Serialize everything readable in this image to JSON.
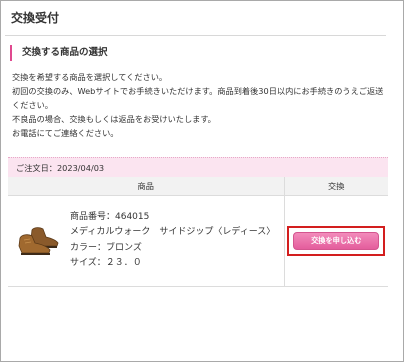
{
  "page": {
    "title": "交換受付"
  },
  "section": {
    "heading": "交換する商品の選択",
    "instructions": [
      "交換を希望する商品を選択してください。",
      "初回の交換のみ、Webサイトでお手続きいただけます。商品到着後30日以内にお手続きのうえご返送",
      "ください。",
      "不良品の場合、交換もしくは返品をお受けいたします。",
      "お電話にてご連絡ください。"
    ]
  },
  "order": {
    "date_label": "ご注文日：2023/04/03"
  },
  "table": {
    "headers": [
      "商品",
      "交換"
    ],
    "rows": [
      {
        "image_icon": "brown-shoe-image",
        "product_number": "商品番号：464015",
        "product_name": "メディカルウォーク　サイドジップ〈レディース〉",
        "color": "カラー：ブロンズ",
        "size": "サイズ：２３．０",
        "action_label": "交換を申し込む"
      }
    ]
  },
  "colors": {
    "accent_pink": "#e45d9c",
    "order_band": "#fbe4f0",
    "highlight_red": "#d31e1e"
  }
}
